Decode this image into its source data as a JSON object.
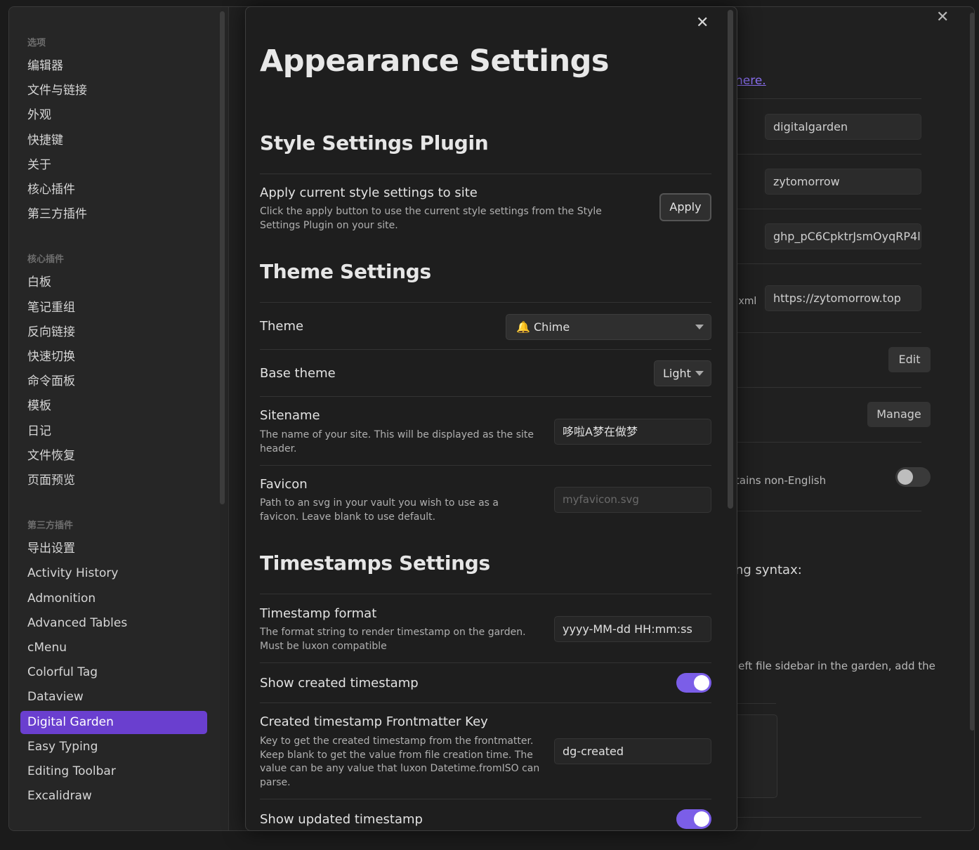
{
  "sidebar": {
    "sections": [
      {
        "heading": "选项",
        "items": [
          "编辑器",
          "文件与链接",
          "外观",
          "快捷键",
          "关于",
          "核心插件",
          "第三方插件"
        ]
      },
      {
        "heading": "核心插件",
        "items": [
          "白板",
          "笔记重组",
          "反向链接",
          "快速切换",
          "命令面板",
          "模板",
          "日记",
          "文件恢复",
          "页面预览"
        ]
      },
      {
        "heading": "第三方插件",
        "items": [
          "导出设置",
          "Activity History",
          "Admonition",
          "Advanced Tables",
          "cMenu",
          "Colorful Tag",
          "Dataview",
          "Digital Garden",
          "Easy Typing",
          "Editing Toolbar",
          "Excalidraw"
        ]
      }
    ],
    "active_item": "Digital Garden"
  },
  "background": {
    "link_fragment": "here.",
    "fields": [
      "digitalgarden",
      "zytomorrow",
      "ghp_pC6CpktrJsmOyqRP4l",
      "https://zytomorrow.top"
    ],
    "label_fragment_xml": ".xml",
    "edit_button": "Edit",
    "manage_button": "Manage",
    "label_fragment_nonenglish": "tains non-English",
    "label_fragment_syntax": "ng syntax:",
    "label_fragment_sidebar": "left file sidebar in the garden, add the",
    "close": "✕"
  },
  "modal": {
    "close": "✕",
    "title": "Appearance Settings",
    "style_section": "Style Settings Plugin",
    "apply": {
      "name": "Apply current style settings to site",
      "desc": "Click the apply button to use the current style settings from the Style Settings Plugin on your site.",
      "button": "Apply"
    },
    "theme_section": "Theme Settings",
    "theme": {
      "name": "Theme",
      "value": "🔔 Chime"
    },
    "base_theme": {
      "name": "Base theme",
      "value": "Light"
    },
    "sitename": {
      "name": "Sitename",
      "desc": "The name of your site. This will be displayed as the site header.",
      "value": "哆啦A梦在做梦"
    },
    "favicon": {
      "name": "Favicon",
      "desc": "Path to an svg in your vault you wish to use as a favicon. Leave blank to use default.",
      "placeholder": "myfavicon.svg"
    },
    "timestamps_section": "Timestamps Settings",
    "timestamp_format": {
      "name": "Timestamp format",
      "desc": "The format string to render timestamp on the garden. Must be luxon compatible",
      "value": "yyyy-MM-dd HH:mm:ss"
    },
    "show_created": {
      "name": "Show created timestamp",
      "on": true
    },
    "created_key": {
      "name": "Created timestamp Frontmatter Key",
      "desc": "Key to get the created timestamp from the frontmatter. Keep blank to get the value from file creation time. The value can be any value that luxon Datetime.fromISO can parse.",
      "value": "dg-created"
    },
    "show_updated": {
      "name": "Show updated timestamp",
      "on": true
    }
  },
  "colors": {
    "accent": "#7b5ee8",
    "active_item": "#6a3fcf"
  }
}
